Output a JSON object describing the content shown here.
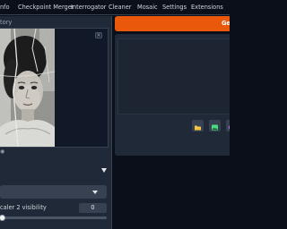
{
  "tabs": [
    {
      "label": "nfo"
    },
    {
      "label": "Checkpoint Merger"
    },
    {
      "label": "Interrogator"
    },
    {
      "label": "Cleaner"
    },
    {
      "label": "Mosaic"
    },
    {
      "label": "Settings"
    },
    {
      "label": "Extensions"
    }
  ],
  "left": {
    "subtab_label": "tory",
    "under_image_text": "◉",
    "upscaler2_visibility": {
      "label": "caler 2 visibility",
      "value": "0",
      "fraction": 0.02
    }
  },
  "right": {
    "generate_label": "Gen"
  },
  "icons": {
    "image_close": "close-icon",
    "folder": "folder-icon",
    "picture": "image-icon",
    "palette": "palette-icon",
    "section_toggle": "caret-down-icon",
    "dropdown": "chevron-down-icon"
  },
  "colors": {
    "background": "#0b0f19",
    "panel": "#1f2937",
    "accent": "#ea580c"
  }
}
